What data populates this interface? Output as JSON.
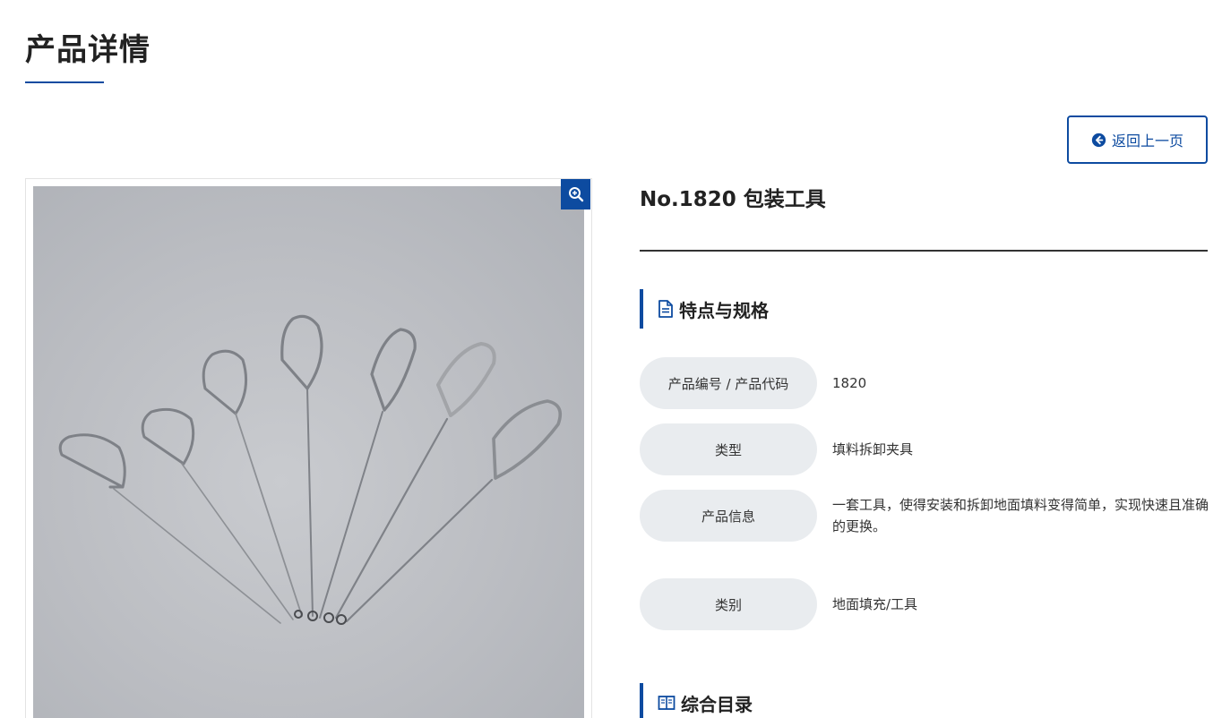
{
  "page": {
    "title": "产品详情"
  },
  "nav": {
    "back_label": "返回上一页"
  },
  "product": {
    "title": "No.1820 包装工具",
    "image_alt": "No.1820 包装工具"
  },
  "specs_section": {
    "heading": "特点与规格",
    "rows": [
      {
        "label": "产品编号 / 产品代码",
        "value": "1820"
      },
      {
        "label": "类型",
        "value": "填料拆卸夹具"
      },
      {
        "label": "产品信息",
        "value": "一套工具，使得安装和拆卸地面填料变得简单，实现快速且准确的更换。"
      },
      {
        "label": "类别",
        "value": "地面填充/工具"
      }
    ]
  },
  "catalog_section": {
    "heading": "综合目录"
  },
  "colors": {
    "accent": "#0d4ba0",
    "label_bg": "#e9ecef"
  },
  "icons": {
    "back": "arrow-circle-left-icon",
    "zoom": "zoom-in-icon",
    "specs": "document-icon",
    "catalog": "book-icon"
  }
}
